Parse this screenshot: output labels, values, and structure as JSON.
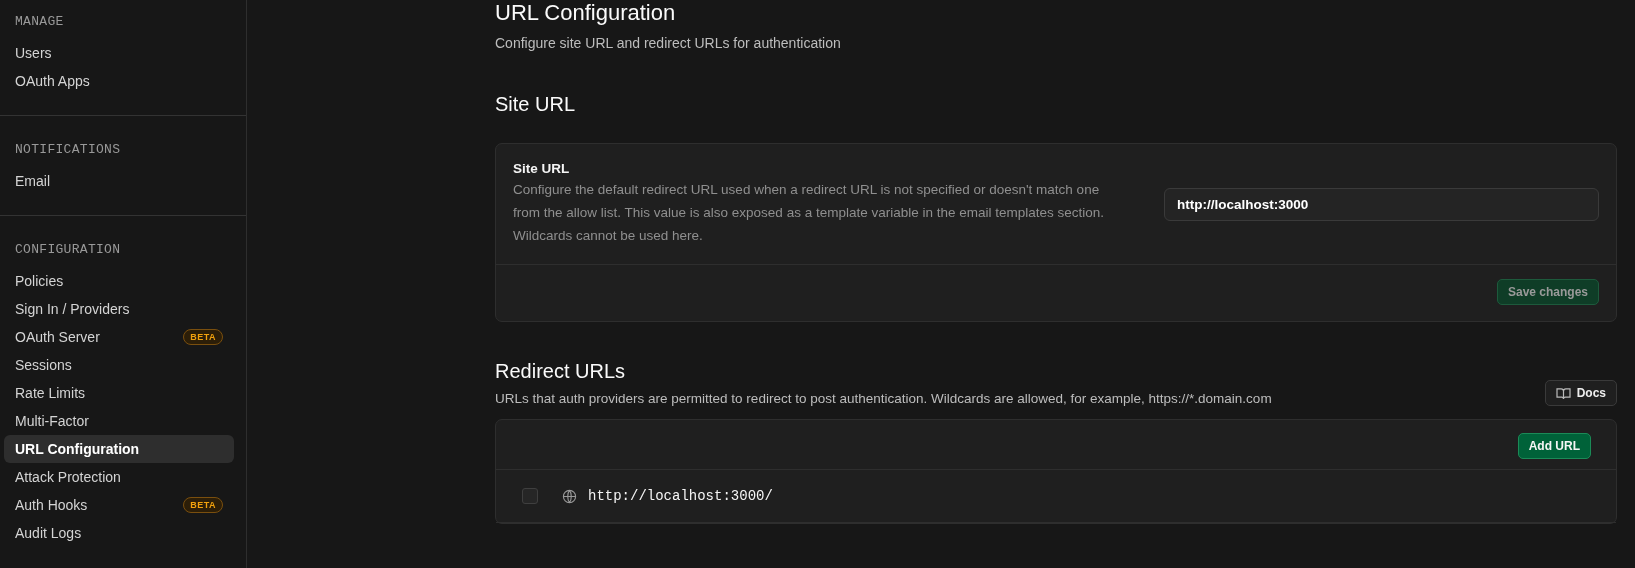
{
  "sidebar": {
    "sections": [
      {
        "title": "MANAGE",
        "items": [
          {
            "label": "Users",
            "selected": false
          },
          {
            "label": "OAuth Apps",
            "selected": false
          }
        ]
      },
      {
        "title": "NOTIFICATIONS",
        "items": [
          {
            "label": "Email",
            "selected": false
          }
        ]
      },
      {
        "title": "CONFIGURATION",
        "items": [
          {
            "label": "Policies",
            "selected": false
          },
          {
            "label": "Sign In / Providers",
            "selected": false
          },
          {
            "label": "OAuth Server",
            "selected": false,
            "badge": "BETA"
          },
          {
            "label": "Sessions",
            "selected": false
          },
          {
            "label": "Rate Limits",
            "selected": false
          },
          {
            "label": "Multi-Factor",
            "selected": false
          },
          {
            "label": "URL Configuration",
            "selected": true
          },
          {
            "label": "Attack Protection",
            "selected": false
          },
          {
            "label": "Auth Hooks",
            "selected": false,
            "badge": "BETA"
          },
          {
            "label": "Audit Logs",
            "selected": false
          }
        ]
      }
    ]
  },
  "page": {
    "title": "URL Configuration",
    "subtitle": "Configure site URL and redirect URLs for authentication"
  },
  "site_url": {
    "heading": "Site URL",
    "label": "Site URL",
    "description": "Configure the default redirect URL used when a redirect URL is not specified or doesn't match one from the allow list. This value is also exposed as a template variable in the email templates section. Wildcards cannot be used here.",
    "value": "http://localhost:3000",
    "save_button": {
      "label": "Save changes",
      "disabled": true
    }
  },
  "redirect_urls": {
    "heading": "Redirect URLs",
    "description": "URLs that auth providers are permitted to redirect to post authentication. Wildcards are allowed, for example, https://*.domain.com",
    "docs_button": "Docs",
    "add_button": "Add URL",
    "rows": [
      {
        "url": "http://localhost:3000/",
        "checked": false
      }
    ]
  }
}
